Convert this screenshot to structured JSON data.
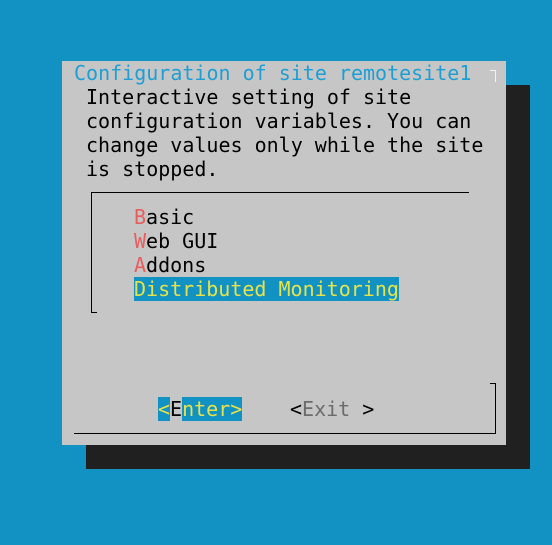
{
  "dialog": {
    "title": "Configuration of site remotesite1",
    "description": [
      "Interactive setting of site",
      "configuration variables. You can",
      "change values only while the site",
      "is stopped."
    ]
  },
  "menu": {
    "items": [
      {
        "hotkey": "B",
        "rest": "asic"
      },
      {
        "hotkey": "W",
        "rest": "eb GUI"
      },
      {
        "hotkey": "A",
        "rest": "ddons"
      },
      {
        "hotkey": "D",
        "rest": "istributed Monitoring"
      }
    ],
    "selected_index": 3
  },
  "buttons": {
    "enter": {
      "open": "<",
      "hotkey": "E",
      "rest": "nter",
      "close": ">"
    },
    "exit": {
      "open": "<",
      "label": "Exit",
      "close": " >"
    }
  },
  "colors": {
    "background": "#1292c2",
    "dialog": "#c6c6c6",
    "title": "#1e9fd4",
    "hotkey": "#e85d5d",
    "selected_text": "#e8e24a"
  }
}
